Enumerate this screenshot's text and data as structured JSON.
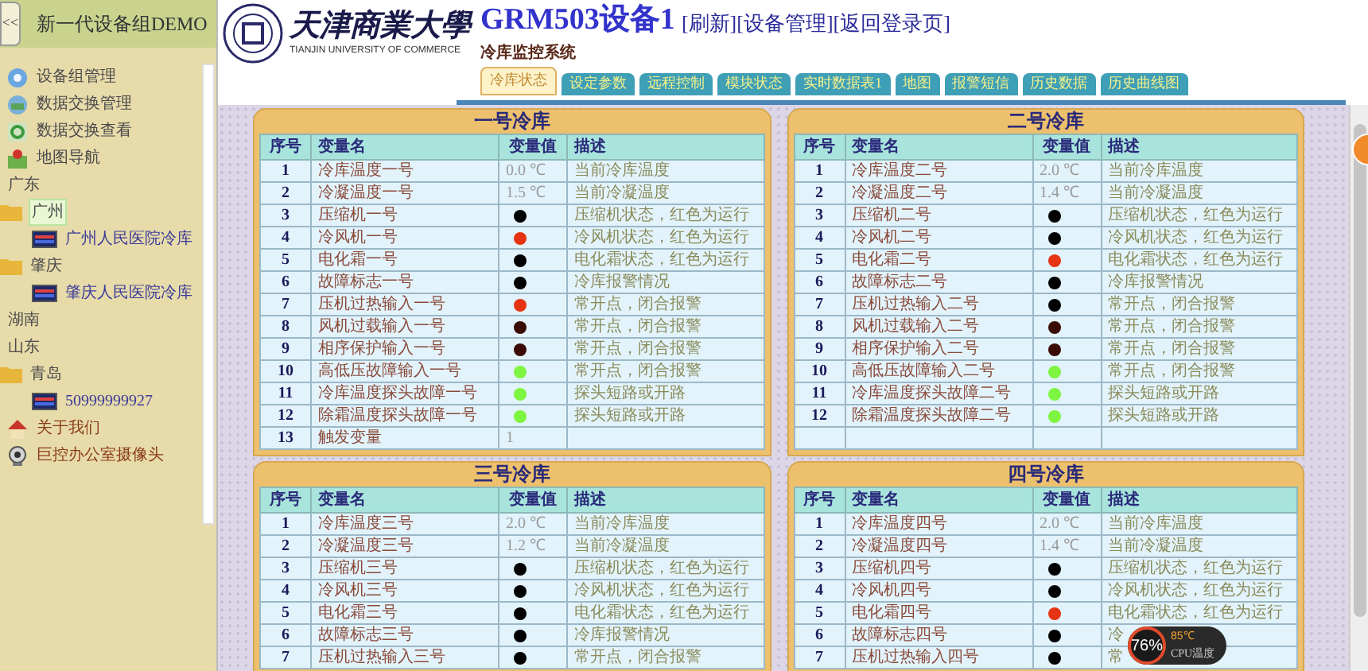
{
  "sidebar": {
    "collapse": "<<",
    "title": "新一代设备组DEMO",
    "items": [
      {
        "kind": "gear",
        "label": "设备组管理"
      },
      {
        "kind": "exchange",
        "label": "数据交换管理"
      },
      {
        "kind": "refresh",
        "label": "数据交换查看"
      },
      {
        "kind": "map",
        "label": "地图导航"
      },
      {
        "kind": "region",
        "label": "广东",
        "children": [
          {
            "kind": "folder",
            "label": "广州",
            "selected": true,
            "children": [
              {
                "kind": "device",
                "label": "广州人民医院冷库",
                "selected": false
              }
            ]
          },
          {
            "kind": "folder",
            "label": "肇庆",
            "selected": false,
            "children": [
              {
                "kind": "device",
                "label": "肇庆人民医院冷库",
                "selected": false
              }
            ]
          }
        ]
      },
      {
        "kind": "region",
        "label": "湖南"
      },
      {
        "kind": "region",
        "label": "山东",
        "children": [
          {
            "kind": "folder",
            "label": "青岛",
            "selected": false,
            "children": [
              {
                "kind": "device",
                "label": "50999999927",
                "selected": false
              }
            ]
          }
        ]
      },
      {
        "kind": "home",
        "label": "关于我们"
      },
      {
        "kind": "camera",
        "label": "巨控办公室摄像头"
      }
    ]
  },
  "header": {
    "logo_cn": "天津商業大學",
    "logo_en": "TIANJIN UNIVERSITY OF COMMERCE",
    "title": "GRM503设备1",
    "links": [
      "[刷新]",
      "[设备管理]",
      "[返回登录页]"
    ],
    "subtitle": "冷库监控系统"
  },
  "tabs": [
    {
      "label": "冷库状态",
      "selected": true
    },
    {
      "label": "设定参数",
      "selected": false
    },
    {
      "label": "远程控制",
      "selected": false
    },
    {
      "label": "模块状态",
      "selected": false
    },
    {
      "label": "实时数据表1",
      "selected": false
    },
    {
      "label": "地图",
      "selected": false
    },
    {
      "label": "报警短信",
      "selected": false
    },
    {
      "label": "历史数据",
      "selected": false
    },
    {
      "label": "历史曲线图",
      "selected": false
    }
  ],
  "panels": [
    {
      "title": "一号冷库",
      "columns": [
        "序号",
        "变量名",
        "变量值",
        "描述"
      ],
      "rows": [
        {
          "index": "1",
          "name": "冷库温度一号",
          "value": {
            "kind": "text",
            "text": "0.0 ℃"
          },
          "description": "当前冷库温度"
        },
        {
          "index": "2",
          "name": "冷凝温度一号",
          "value": {
            "kind": "text",
            "text": "1.5 ℃"
          },
          "description": "当前冷凝温度"
        },
        {
          "index": "3",
          "name": "压缩机一号",
          "value": {
            "kind": "dot",
            "color": "#000000"
          },
          "description": "压缩机状态，红色为运行"
        },
        {
          "index": "4",
          "name": "冷风机一号",
          "value": {
            "kind": "dot",
            "color": "#e63312"
          },
          "description": "冷风机状态，红色为运行"
        },
        {
          "index": "5",
          "name": "电化霜一号",
          "value": {
            "kind": "dot",
            "color": "#000000"
          },
          "description": "电化霜状态，红色为运行"
        },
        {
          "index": "6",
          "name": "故障标志一号",
          "value": {
            "kind": "dot",
            "color": "#000000"
          },
          "description": "冷库报警情况"
        },
        {
          "index": "7",
          "name": "压机过热输入一号",
          "value": {
            "kind": "dot",
            "color": "#e63312"
          },
          "description": "常开点，闭合报警"
        },
        {
          "index": "8",
          "name": "风机过载输入一号",
          "value": {
            "kind": "dot",
            "color": "#3a0a05"
          },
          "description": "常开点，闭合报警"
        },
        {
          "index": "9",
          "name": "相序保护输入一号",
          "value": {
            "kind": "dot",
            "color": "#3a0a05"
          },
          "description": "常开点，闭合报警"
        },
        {
          "index": "10",
          "name": "高低压故障输入一号",
          "value": {
            "kind": "dot",
            "color": "#7ef540"
          },
          "description": "常开点，闭合报警"
        },
        {
          "index": "11",
          "name": "冷库温度探头故障一号",
          "value": {
            "kind": "dot",
            "color": "#7ef540"
          },
          "description": "探头短路或开路"
        },
        {
          "index": "12",
          "name": "除霜温度探头故障一号",
          "value": {
            "kind": "dot",
            "color": "#7ef540"
          },
          "description": "探头短路或开路"
        },
        {
          "index": "13",
          "name": "触发变量",
          "value": {
            "kind": "text",
            "text": "1"
          }
        }
      ]
    },
    {
      "title": "二号冷库",
      "columns": [
        "序号",
        "变量名",
        "变量值",
        "描述"
      ],
      "rows": [
        {
          "index": "1",
          "name": "冷库温度二号",
          "value": {
            "kind": "text",
            "text": "2.0 ℃"
          },
          "description": "当前冷库温度"
        },
        {
          "index": "2",
          "name": "冷凝温度二号",
          "value": {
            "kind": "text",
            "text": "1.4 ℃"
          },
          "description": "当前冷凝温度"
        },
        {
          "index": "3",
          "name": "压缩机二号",
          "value": {
            "kind": "dot",
            "color": "#000000"
          },
          "description": "压缩机状态，红色为运行"
        },
        {
          "index": "4",
          "name": "冷风机二号",
          "value": {
            "kind": "dot",
            "color": "#000000"
          },
          "description": "冷风机状态，红色为运行"
        },
        {
          "index": "5",
          "name": "电化霜二号",
          "value": {
            "kind": "dot",
            "color": "#e63312"
          },
          "description": "电化霜状态，红色为运行"
        },
        {
          "index": "6",
          "name": "故障标志二号",
          "value": {
            "kind": "dot",
            "color": "#000000"
          },
          "description": "冷库报警情况"
        },
        {
          "index": "7",
          "name": "压机过热输入二号",
          "value": {
            "kind": "dot",
            "color": "#000000"
          },
          "description": "常开点，闭合报警"
        },
        {
          "index": "8",
          "name": "风机过载输入二号",
          "value": {
            "kind": "dot",
            "color": "#3a0a05"
          },
          "description": "常开点，闭合报警"
        },
        {
          "index": "9",
          "name": "相序保护输入二号",
          "value": {
            "kind": "dot",
            "color": "#3a0a05"
          },
          "description": "常开点，闭合报警"
        },
        {
          "index": "10",
          "name": "高低压故障输入二号",
          "value": {
            "kind": "dot",
            "color": "#7ef540"
          },
          "description": "常开点，闭合报警"
        },
        {
          "index": "11",
          "name": "冷库温度探头故障二号",
          "value": {
            "kind": "dot",
            "color": "#7ef540"
          },
          "description": "探头短路或开路"
        },
        {
          "index": "12",
          "name": "除霜温度探头故障二号",
          "value": {
            "kind": "dot",
            "color": "#7ef540"
          },
          "description": "探头短路或开路"
        }
      ]
    },
    {
      "title": "三号冷库",
      "columns": [
        "序号",
        "变量名",
        "变量值",
        "描述"
      ],
      "rows": [
        {
          "index": "1",
          "name": "冷库温度三号",
          "value": {
            "kind": "text",
            "text": "2.0 ℃"
          },
          "description": "当前冷库温度"
        },
        {
          "index": "2",
          "name": "冷凝温度三号",
          "value": {
            "kind": "text",
            "text": "1.2 ℃"
          },
          "description": "当前冷凝温度"
        },
        {
          "index": "3",
          "name": "压缩机三号",
          "value": {
            "kind": "dot",
            "color": "#000000"
          },
          "description": "压缩机状态，红色为运行"
        },
        {
          "index": "4",
          "name": "冷风机三号",
          "value": {
            "kind": "dot",
            "color": "#000000"
          },
          "description": "冷风机状态，红色为运行"
        },
        {
          "index": "5",
          "name": "电化霜三号",
          "value": {
            "kind": "dot",
            "color": "#000000"
          },
          "description": "电化霜状态，红色为运行"
        },
        {
          "index": "6",
          "name": "故障标志三号",
          "value": {
            "kind": "dot",
            "color": "#000000"
          },
          "description": "冷库报警情况"
        },
        {
          "index": "7",
          "name": "压机过热输入三号",
          "value": {
            "kind": "dot",
            "color": "#000000"
          },
          "description": "常开点，闭合报警"
        }
      ]
    },
    {
      "title": "四号冷库",
      "columns": [
        "序号",
        "变量名",
        "变量值",
        "描述"
      ],
      "rows": [
        {
          "index": "1",
          "name": "冷库温度四号",
          "value": {
            "kind": "text",
            "text": "2.0 ℃"
          },
          "description": "当前冷库温度"
        },
        {
          "index": "2",
          "name": "冷凝温度四号",
          "value": {
            "kind": "text",
            "text": "1.4 ℃"
          },
          "description": "当前冷凝温度"
        },
        {
          "index": "3",
          "name": "压缩机四号",
          "value": {
            "kind": "dot",
            "color": "#000000"
          },
          "description": "压缩机状态，红色为运行"
        },
        {
          "index": "4",
          "name": "冷风机四号",
          "value": {
            "kind": "dot",
            "color": "#000000"
          },
          "description": "冷风机状态，红色为运行"
        },
        {
          "index": "5",
          "name": "电化霜四号",
          "value": {
            "kind": "dot",
            "color": "#e63312"
          },
          "description": "电化霜状态，红色为运行"
        },
        {
          "index": "6",
          "name": "故障标志四号",
          "value": {
            "kind": "dot",
            "color": "#000000"
          },
          "description": "冷"
        },
        {
          "index": "7",
          "name": "压机过热输入四号",
          "value": {
            "kind": "dot",
            "color": "#000000"
          },
          "description": "常"
        }
      ]
    }
  ],
  "cpu_widget": {
    "usage": "76%",
    "temperature": "85℃",
    "label": "CPU温度"
  }
}
